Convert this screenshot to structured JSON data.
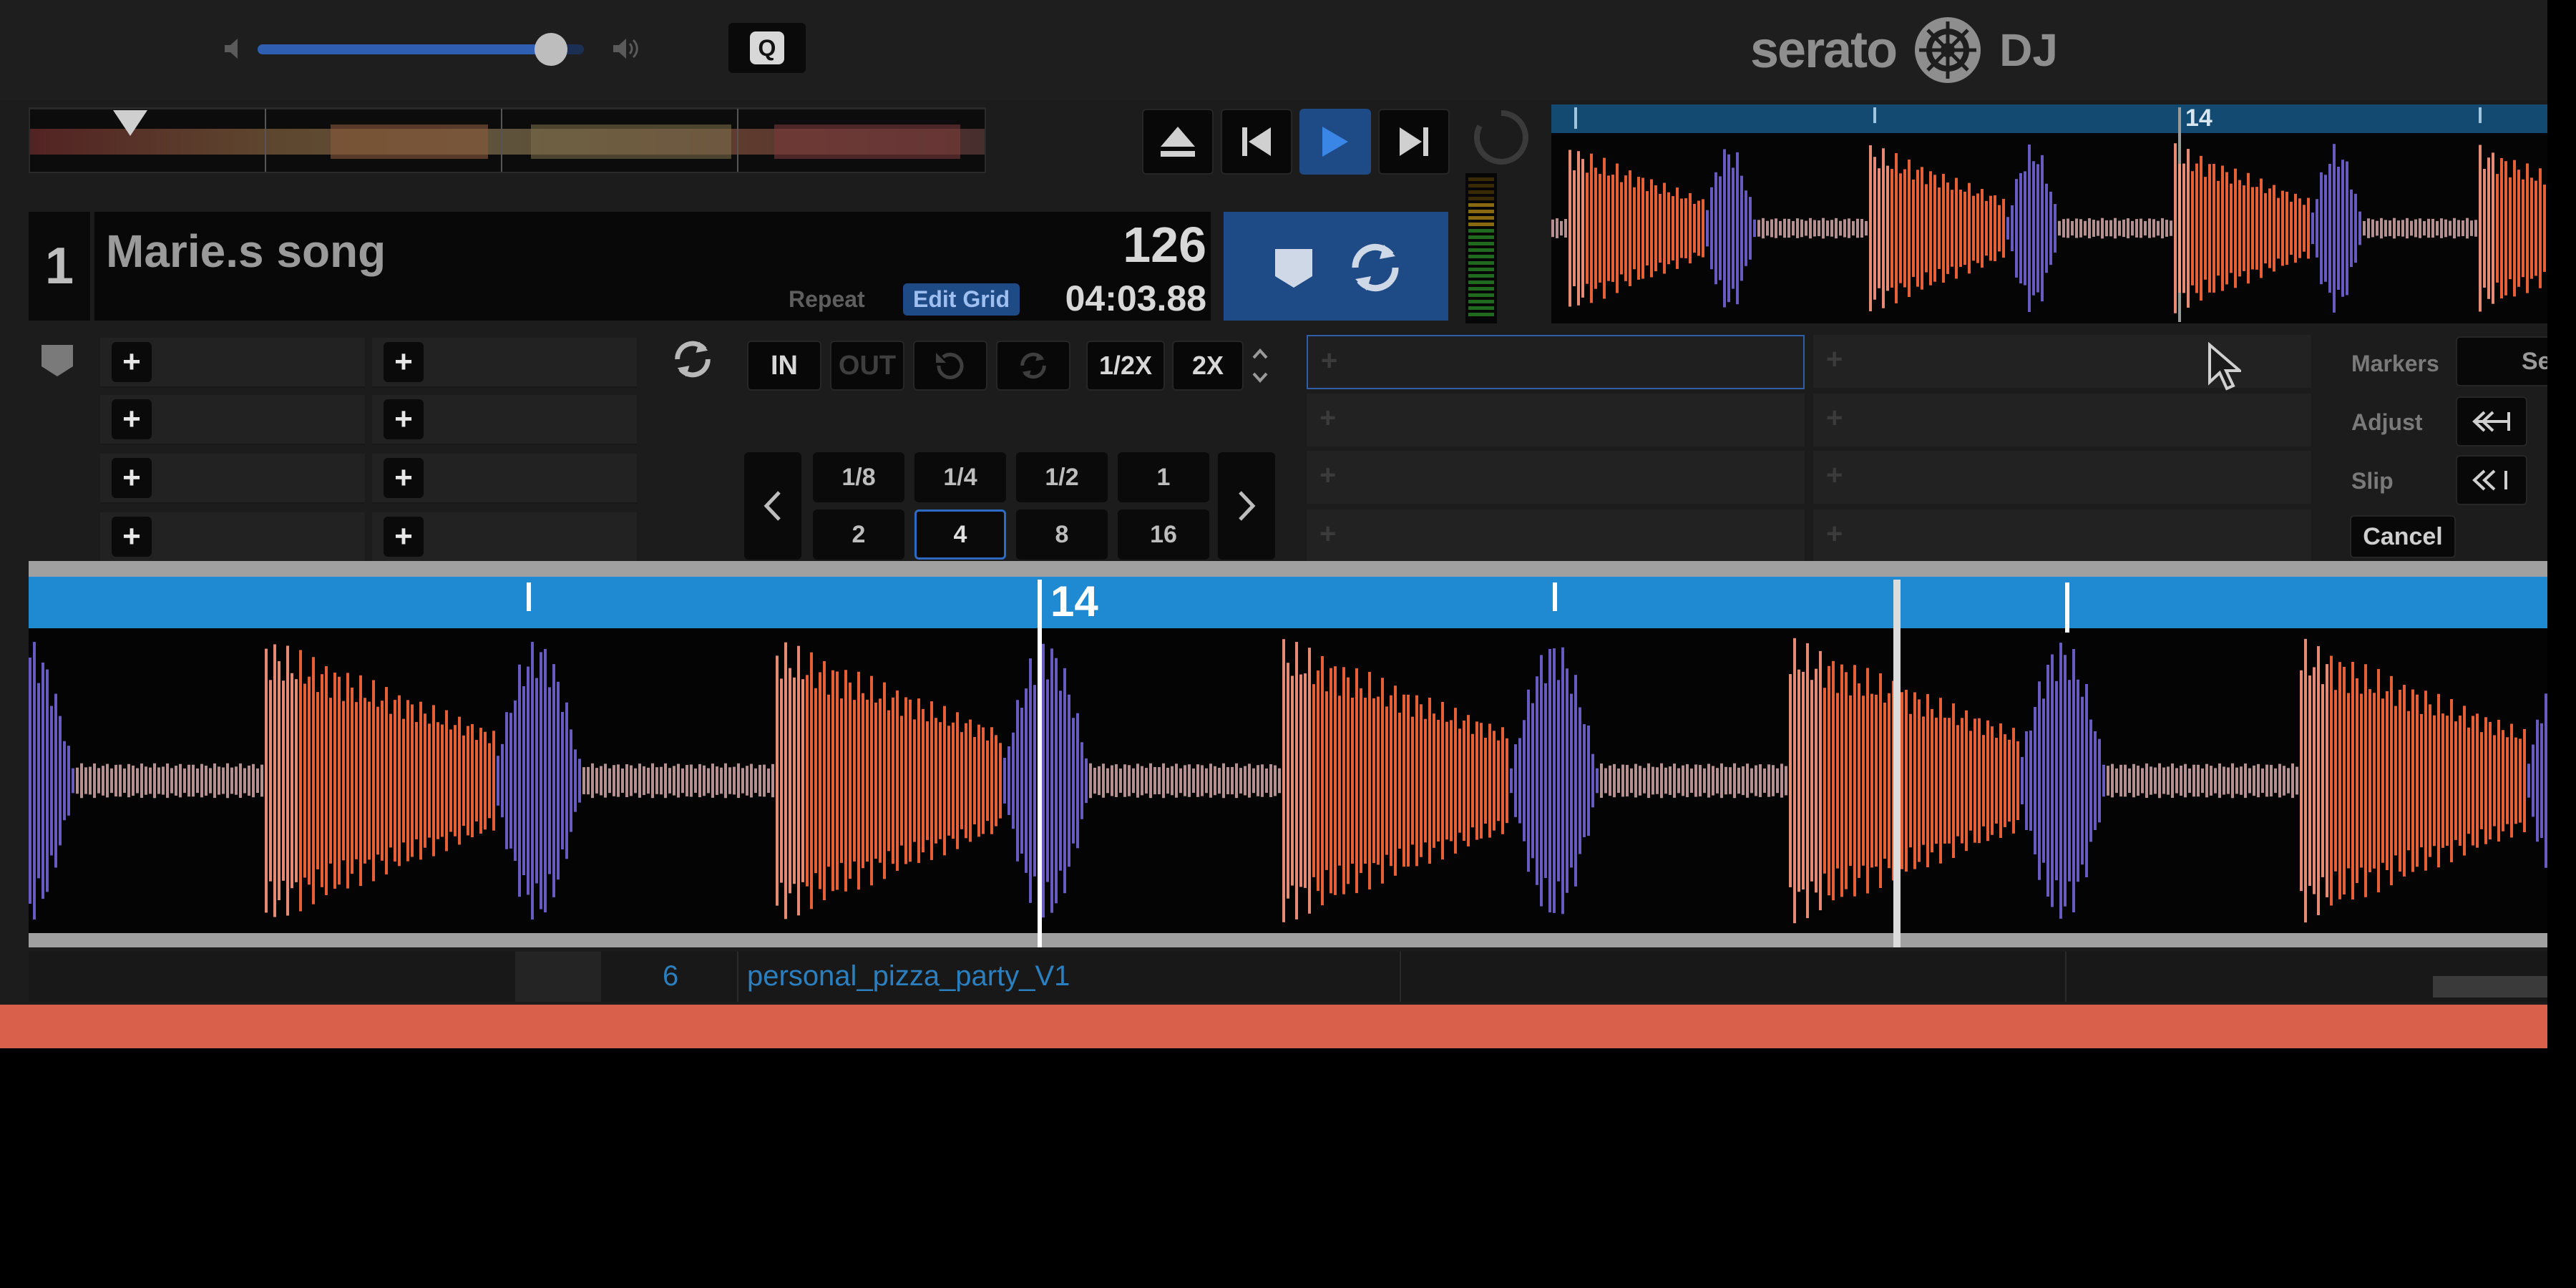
{
  "brand": {
    "name": "serato",
    "suffix": "DJ"
  },
  "quantize_label": "Q",
  "volume_level": 0.9,
  "deck": {
    "number": "1",
    "track_title": "Marie.s song",
    "bpm": "126",
    "time_remaining": "04:03.88",
    "repeat_label": "Repeat",
    "edit_grid_label": "Edit Grid"
  },
  "loop_controls": {
    "in_label": "IN",
    "out_label": "OUT",
    "half_label": "1/2X",
    "double_label": "2X",
    "beat_values": [
      "1/8",
      "1/4",
      "1/2",
      "1",
      "2",
      "4",
      "8",
      "16"
    ],
    "selected_beat": "4"
  },
  "beatgrid_panel": {
    "markers_label": "Markers",
    "markers_value": "Se",
    "adjust_label": "Adjust",
    "slip_label": "Slip",
    "cancel_label": "Cancel"
  },
  "waveform": {
    "bar_marker": "14",
    "overview_bar_marker": "14"
  },
  "library": {
    "row_number": "6",
    "row_title": "personal_pizza_party_V1"
  },
  "colors": {
    "accent_blue": "#1f8ad2",
    "waveform_orange": "#ff6a3d",
    "waveform_purple": "#8a78ff",
    "bottom_bar": "#d9614c"
  },
  "icons": [
    "volume-low-icon",
    "volume-high-icon",
    "eject-icon",
    "previous-track-icon",
    "play-icon",
    "next-track-icon",
    "loop-icon",
    "cue-marker-icon",
    "chevron-left-icon",
    "chevron-right-icon",
    "cursor-icon",
    "serato-logo-icon"
  ]
}
